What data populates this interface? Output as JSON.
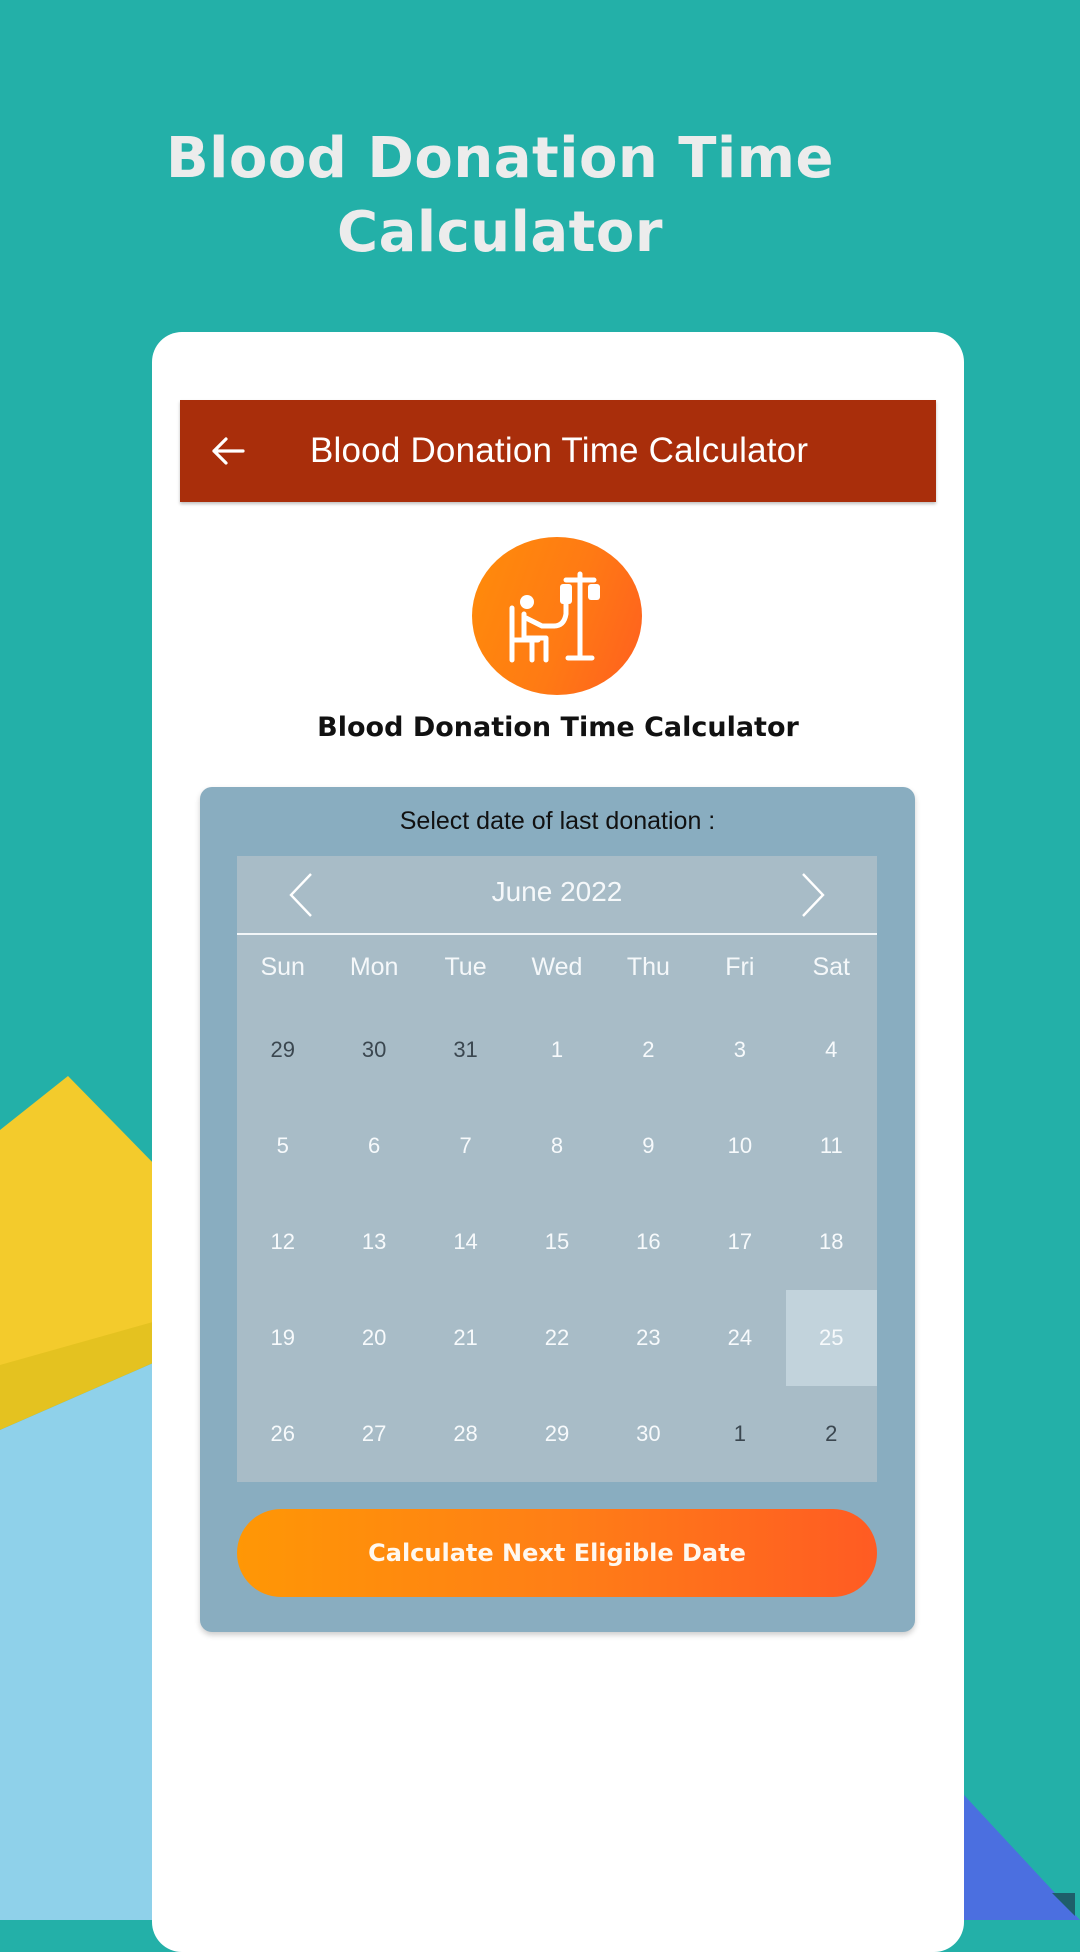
{
  "promo": {
    "title_line1": "Blood Donation Time",
    "title_line2": "Calculator"
  },
  "colors": {
    "background": "#23b0a8",
    "app_bar": "#a92e0b",
    "panel": "#89adc0",
    "calendar": "#a8bcc7",
    "selected_day": "#c2d3dc",
    "button_gradient_start": "#ff9705",
    "button_gradient_end": "#ff5b23"
  },
  "app_bar": {
    "back_icon": "arrow-left-icon",
    "title": "Blood Donation Time Calculator"
  },
  "hero": {
    "icon": "blood-donor-iv-stand-icon",
    "subtitle": "Blood Donation Time Calculator"
  },
  "panel": {
    "label": "Select date of last donation :"
  },
  "calendar": {
    "month_label": "June 2022",
    "prev_icon": "chevron-left-icon",
    "next_icon": "chevron-right-icon",
    "weekdays": [
      "Sun",
      "Mon",
      "Tue",
      "Wed",
      "Thu",
      "Fri",
      "Sat"
    ],
    "selected_day": "25",
    "weeks": [
      [
        {
          "d": "29",
          "other": true
        },
        {
          "d": "30",
          "other": true
        },
        {
          "d": "31",
          "other": true
        },
        {
          "d": "1"
        },
        {
          "d": "2"
        },
        {
          "d": "3"
        },
        {
          "d": "4"
        }
      ],
      [
        {
          "d": "5"
        },
        {
          "d": "6"
        },
        {
          "d": "7"
        },
        {
          "d": "8"
        },
        {
          "d": "9"
        },
        {
          "d": "10"
        },
        {
          "d": "11"
        }
      ],
      [
        {
          "d": "12"
        },
        {
          "d": "13"
        },
        {
          "d": "14"
        },
        {
          "d": "15"
        },
        {
          "d": "16"
        },
        {
          "d": "17"
        },
        {
          "d": "18"
        }
      ],
      [
        {
          "d": "19"
        },
        {
          "d": "20"
        },
        {
          "d": "21"
        },
        {
          "d": "22"
        },
        {
          "d": "23"
        },
        {
          "d": "24"
        },
        {
          "d": "25",
          "selected": true
        }
      ],
      [
        {
          "d": "26"
        },
        {
          "d": "27"
        },
        {
          "d": "28"
        },
        {
          "d": "29"
        },
        {
          "d": "30"
        },
        {
          "d": "1",
          "other": true
        },
        {
          "d": "2",
          "other": true
        }
      ]
    ]
  },
  "actions": {
    "calculate_label": "Calculate Next Eligible Date"
  }
}
